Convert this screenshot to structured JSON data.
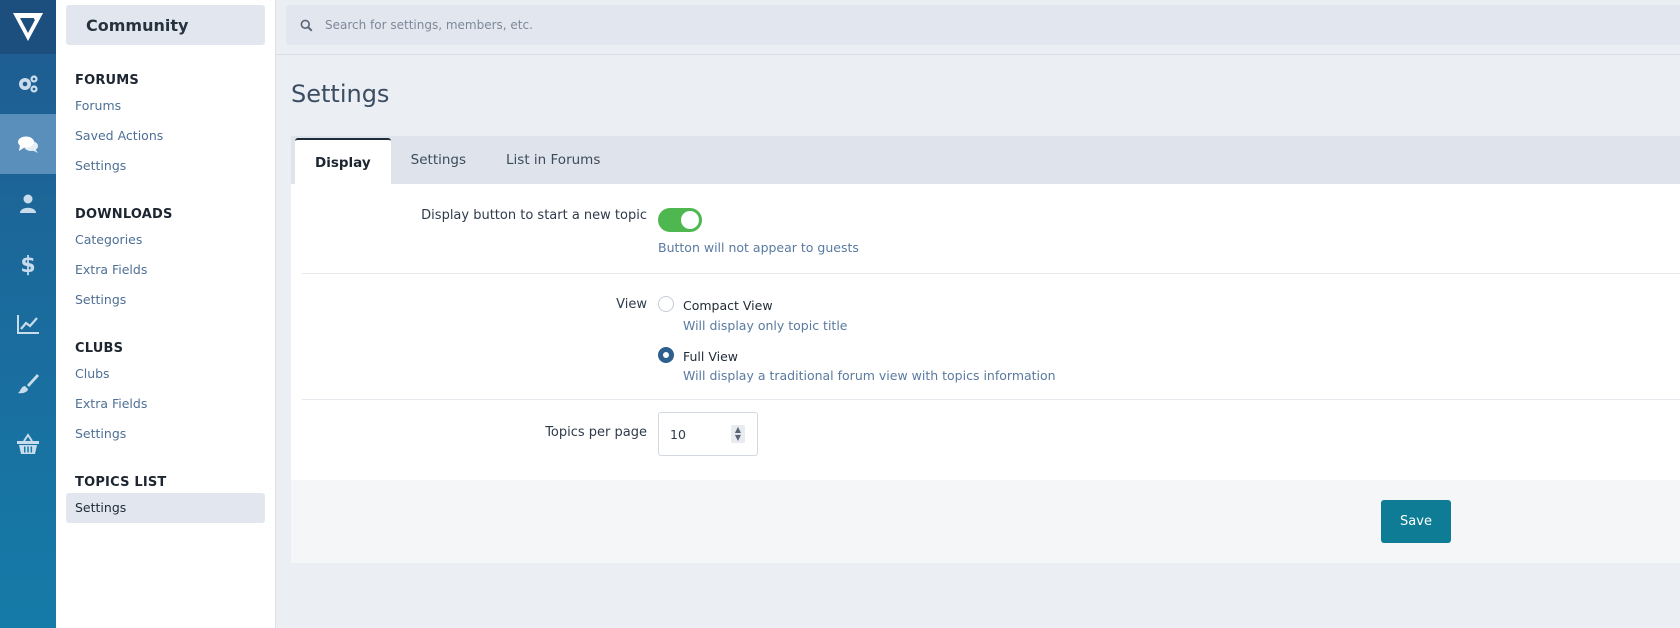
{
  "rail": {
    "items": [
      {
        "name": "system",
        "icon": "gears-icon"
      },
      {
        "name": "community",
        "icon": "chat-bubbles-icon"
      },
      {
        "name": "members",
        "icon": "user-icon"
      },
      {
        "name": "commerce",
        "icon": "dollar-icon"
      },
      {
        "name": "stats",
        "icon": "chart-line-icon"
      },
      {
        "name": "customization",
        "icon": "brush-icon"
      },
      {
        "name": "marketplace",
        "icon": "basket-icon"
      }
    ],
    "active": "community"
  },
  "sidebar": {
    "title": "Community",
    "sections": [
      {
        "heading": "FORUMS",
        "links": [
          "Forums",
          "Saved Actions",
          "Settings"
        ]
      },
      {
        "heading": "DOWNLOADS",
        "links": [
          "Categories",
          "Extra Fields",
          "Settings"
        ]
      },
      {
        "heading": "CLUBS",
        "links": [
          "Clubs",
          "Extra Fields",
          "Settings"
        ]
      },
      {
        "heading": "TOPICS LIST",
        "links": [
          "Settings"
        ]
      }
    ]
  },
  "search": {
    "placeholder": "Search for settings, members, etc."
  },
  "page": {
    "title": "Settings"
  },
  "tabs": [
    "Display",
    "Settings",
    "List in Forums"
  ],
  "form": {
    "new_topic": {
      "label": "Display button to start a new topic",
      "enabled": true,
      "description": "Button will not appear to guests"
    },
    "view": {
      "label": "View",
      "options": [
        {
          "label": "Compact View",
          "description": "Will display only topic title",
          "checked": false
        },
        {
          "label": "Full View",
          "description": "Will display a traditional forum view with topics information",
          "checked": true
        }
      ]
    },
    "per_page": {
      "label": "Topics per page",
      "value": "10"
    }
  },
  "footer": {
    "save_label": "Save"
  },
  "colors": {
    "accent": "#0e7c95",
    "toggle_on": "#4fb750",
    "rail": "#1b6a9c"
  }
}
